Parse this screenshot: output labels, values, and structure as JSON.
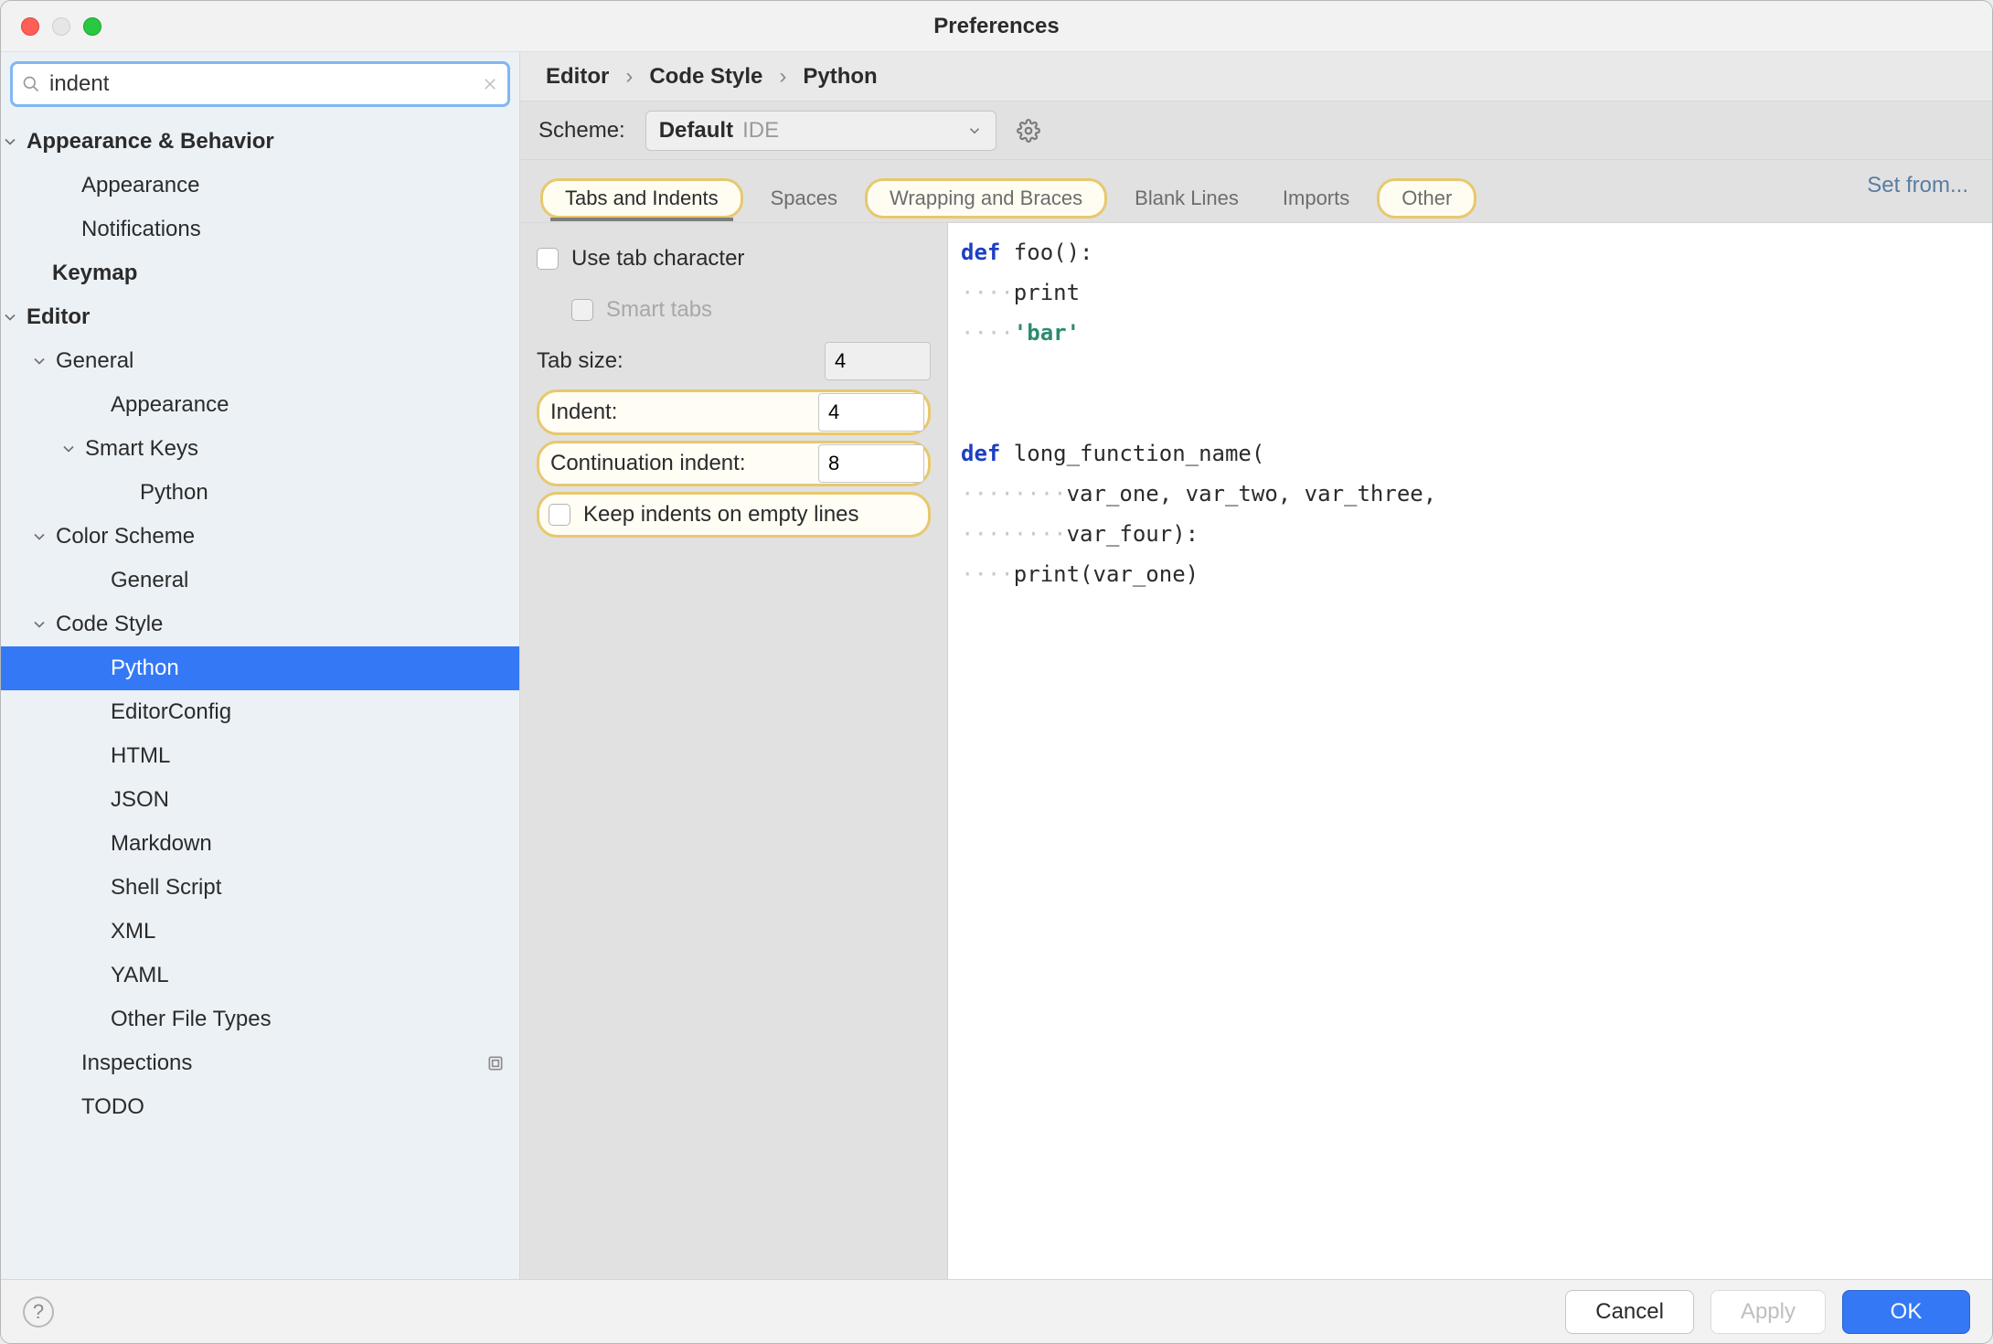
{
  "window": {
    "title": "Preferences"
  },
  "search": {
    "value": "indent"
  },
  "sidebar": {
    "items": [
      {
        "label": "Appearance & Behavior",
        "bold": true,
        "indent": 28,
        "arrow": true
      },
      {
        "label": "Appearance",
        "indent": 88
      },
      {
        "label": "Notifications",
        "indent": 88
      },
      {
        "label": "Keymap",
        "bold": true,
        "indent": 56
      },
      {
        "label": "Editor",
        "bold": true,
        "indent": 28,
        "arrow": true
      },
      {
        "label": "General",
        "indent": 60,
        "arrow": true
      },
      {
        "label": "Appearance",
        "indent": 120
      },
      {
        "label": "Smart Keys",
        "indent": 92,
        "arrow": true
      },
      {
        "label": "Python",
        "indent": 152
      },
      {
        "label": "Color Scheme",
        "indent": 60,
        "arrow": true
      },
      {
        "label": "General",
        "indent": 120
      },
      {
        "label": "Code Style",
        "indent": 60,
        "arrow": true
      },
      {
        "label": "Python",
        "indent": 120,
        "selected": true
      },
      {
        "label": "EditorConfig",
        "indent": 120
      },
      {
        "label": "HTML",
        "indent": 120
      },
      {
        "label": "JSON",
        "indent": 120
      },
      {
        "label": "Markdown",
        "indent": 120
      },
      {
        "label": "Shell Script",
        "indent": 120
      },
      {
        "label": "XML",
        "indent": 120
      },
      {
        "label": "YAML",
        "indent": 120
      },
      {
        "label": "Other File Types",
        "indent": 120
      },
      {
        "label": "Inspections",
        "indent": 88,
        "badge": true
      },
      {
        "label": "TODO",
        "indent": 88
      }
    ]
  },
  "breadcrumb": {
    "p0": "Editor",
    "p1": "Code Style",
    "p2": "Python"
  },
  "scheme": {
    "label": "Scheme:",
    "value": "Default",
    "scope": "IDE"
  },
  "setfrom": "Set from...",
  "tabs": [
    {
      "label": "Tabs and Indents",
      "active": true,
      "highlight": true
    },
    {
      "label": "Spaces"
    },
    {
      "label": "Wrapping and Braces",
      "highlight": true
    },
    {
      "label": "Blank Lines"
    },
    {
      "label": "Imports"
    },
    {
      "label": "Other",
      "highlight": true
    }
  ],
  "form": {
    "use_tab_char": "Use tab character",
    "smart_tabs": "Smart tabs",
    "tab_size_label": "Tab size:",
    "tab_size_value": "4",
    "indent_label": "Indent:",
    "indent_value": "4",
    "cont_label": "Continuation indent:",
    "cont_value": "8",
    "keep_indents": "Keep indents on empty lines"
  },
  "preview": {
    "lines": [
      {
        "segs": [
          {
            "t": "def ",
            "c": "kw"
          },
          {
            "t": "foo():"
          }
        ]
      },
      {
        "segs": [
          {
            "t": "····",
            "c": "dots"
          },
          {
            "t": "print"
          }
        ]
      },
      {
        "segs": [
          {
            "t": "····",
            "c": "dots"
          },
          {
            "t": "'bar'",
            "c": "str"
          }
        ]
      },
      {
        "segs": []
      },
      {
        "segs": []
      },
      {
        "segs": [
          {
            "t": "def ",
            "c": "kw"
          },
          {
            "t": "long_function_name("
          }
        ]
      },
      {
        "segs": [
          {
            "t": "········",
            "c": "dots"
          },
          {
            "t": "var_one, var_two, var_three,"
          }
        ]
      },
      {
        "segs": [
          {
            "t": "········",
            "c": "dots"
          },
          {
            "t": "var_four):"
          }
        ]
      },
      {
        "segs": [
          {
            "t": "····",
            "c": "dots"
          },
          {
            "t": "print(var_one)"
          }
        ]
      }
    ]
  },
  "footer": {
    "cancel": "Cancel",
    "apply": "Apply",
    "ok": "OK"
  }
}
